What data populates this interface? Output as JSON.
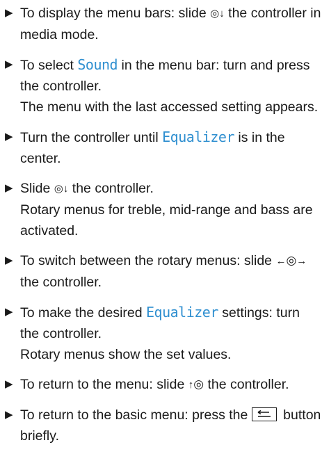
{
  "bullet_glyph": "▶",
  "controller": {
    "slide_down": "◎↓",
    "slide_left_right_left": "←",
    "slide_left_right_knob": "◎",
    "slide_left_right_right": "→",
    "slide_up_arrow": "↑",
    "slide_up_knob": "◎"
  },
  "steps": [
    {
      "pre": "To display the menu bars: slide ",
      "post": " the controller in media mode."
    },
    {
      "pre": "To select ",
      "ui": "Sound",
      "post": " in the menu bar: turn and press the controller.",
      "result": "The menu with the last accessed setting appears."
    },
    {
      "pre": "Turn the controller until ",
      "ui": "Equalizer",
      "post": " is in the center."
    },
    {
      "pre": "Slide ",
      "post": " the controller.",
      "result": "Rotary menus for treble, mid-range and bass are activated."
    },
    {
      "pre": "To switch between the rotary menus: slide ",
      "post": " the controller."
    },
    {
      "pre": "To make the desired ",
      "ui": "Equalizer",
      "post": " settings: turn the controller.",
      "result": "Rotary menus show the set values."
    },
    {
      "pre": "To return to the menu: slide ",
      "post": " the controller."
    },
    {
      "pre": "To return to the basic menu: press the ",
      "post": " button briefly."
    }
  ]
}
